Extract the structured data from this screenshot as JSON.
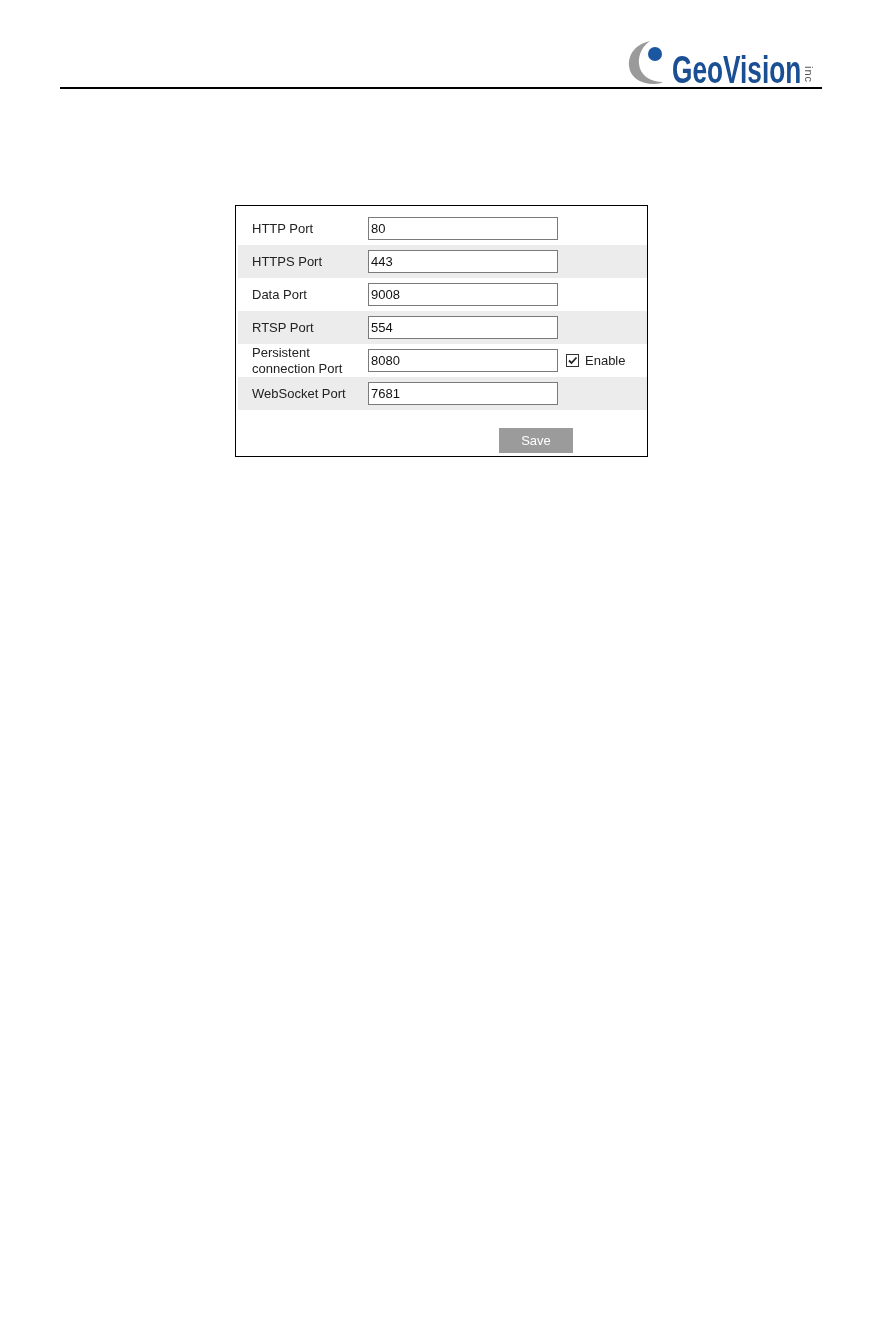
{
  "header": {
    "logo": {
      "name": "GeoVision",
      "suffix": "inc"
    }
  },
  "form": {
    "rows": [
      {
        "label": "HTTP Port",
        "value": "80"
      },
      {
        "label": "HTTPS Port",
        "value": "443"
      },
      {
        "label": "Data Port",
        "value": "9008"
      },
      {
        "label": "RTSP Port",
        "value": "554"
      },
      {
        "label": "Persistent connection Port",
        "value": "8080",
        "option": {
          "label": "Enable",
          "checked": true
        }
      },
      {
        "label": "WebSocket Port",
        "value": "7681"
      }
    ],
    "save_button": "Save"
  }
}
